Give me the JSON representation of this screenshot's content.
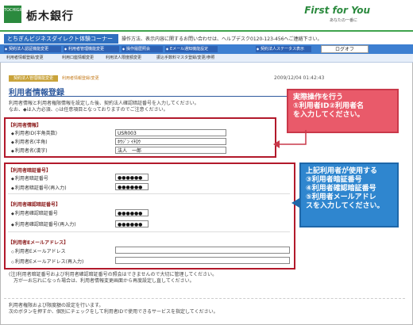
{
  "header": {
    "logo_text": "TOCHIGIN",
    "bank_name": "栃木銀行",
    "slogan": "First for You",
    "slogan_sub": "あなたの一番に"
  },
  "service_bar": {
    "name": "とちぎんビジネスダイレクト体験コーナー",
    "help_text": "操作方法、表示内容に関するお問い合わせは、ヘルプデスク0120-123-456へご連絡下さい。"
  },
  "nav": {
    "tabs": [
      {
        "label": "契約法人認証機能変更"
      },
      {
        "label": "利用者管理機能変更"
      },
      {
        "label": "操作履歴照会"
      },
      {
        "label": "Eメール通知機能設定"
      },
      {
        "label": "契約法人ステータス表示"
      }
    ],
    "logout": "ログオフ"
  },
  "subnav": {
    "items": [
      "利用者情報登録/変更",
      "利用口座情報変更",
      "利用法人限度額変更",
      "振込手数料マスタ登録/変更/参照"
    ]
  },
  "breadcrumb": {
    "active": "契約法人管理機能変更",
    "current": "利用者情報登録/変更"
  },
  "datetime": "2009/12/04  01:42:43",
  "page_title": "利用者情報登録",
  "intro": {
    "line1": "利用者情報と利用者権限情報を設定した後、契約法人確認暗証番号を入力してください。",
    "line2": "なお、◆は入力必須、◇は任意項目となっておりますのでご注意ください。"
  },
  "section_user_info": {
    "heading": "【利用者情報】",
    "fields": [
      {
        "label": "利用者ID(半角英数)",
        "value": "USR003"
      },
      {
        "label": "利用者名(半角)",
        "value": "ﾎｳｼﾞﾝ ｲﾁﾛｳ"
      },
      {
        "label": "利用者名(漢字)",
        "value": "法人　一郎"
      }
    ]
  },
  "section_pw": {
    "heading": "【利用者暗証番号】",
    "fields": [
      {
        "label": "利用者暗証番号",
        "value": "●●●●●●"
      },
      {
        "label": "利用者暗証番号(再入力)",
        "value": "●●●●●●"
      }
    ]
  },
  "section_confirm_pw": {
    "heading": "【利用者確認暗証番号】",
    "fields": [
      {
        "label": "利用者確認暗証番号",
        "value": "●●●●●●"
      },
      {
        "label": "利用者確認暗証番号(再入力)",
        "value": "●●●●●●"
      }
    ]
  },
  "section_email": {
    "heading": "【利用者Eメールアドレス】",
    "fields": [
      {
        "label": "利用者Eメールアドレス",
        "value": ""
      },
      {
        "label": "利用者Eメールアドレス(再入力)",
        "value": ""
      }
    ]
  },
  "note": {
    "line1": "(注)利用者暗証番号および利用者確認暗証番号の照会はできませんので大切に管理してください。",
    "line2": "万が一お忘れになった場合は、利用者情報変更画面から再度設定し直してください。"
  },
  "bottom": {
    "line1": "利用者権限および限度額の設定を行います。",
    "line2": "次のボタンを押すか、個別にチェックをして利用者IDで使用できるサービスを指定してください。"
  },
  "callout_red": {
    "line1": "実際操作を行う",
    "line2": "①利用者ID②利用者名",
    "line3": "を入力してください。"
  },
  "callout_blue": {
    "line1": "上記利用者が使用する",
    "line2": "③利用者暗証番号",
    "line3": "④利用者確認暗証番号",
    "line4": "⑤利用者メールアドレ",
    "line5": "スを入力してください。"
  },
  "colors": {
    "brand_green": "#2b8a3e",
    "nav_blue": "#3d7fd1",
    "highlight_red": "#b2192b",
    "callout_red": "#e95a6a",
    "callout_blue": "#2f86cf"
  }
}
